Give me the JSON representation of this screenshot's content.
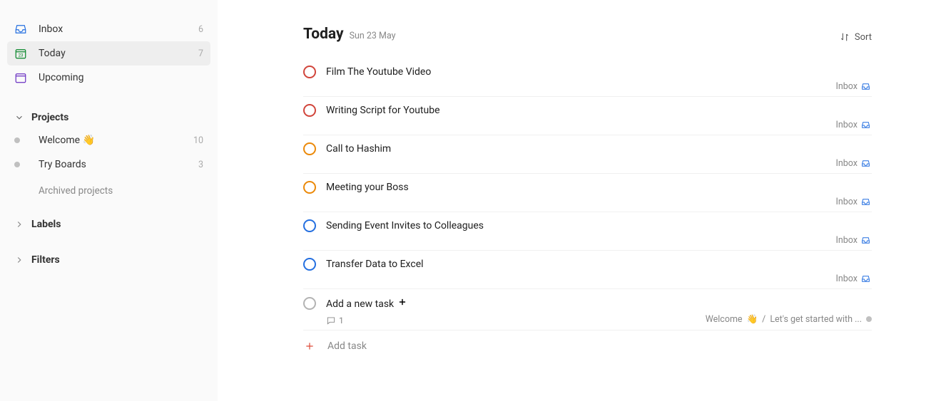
{
  "sidebar": {
    "nav": [
      {
        "key": "inbox",
        "label": "Inbox",
        "count": "6"
      },
      {
        "key": "today",
        "label": "Today",
        "count": "7"
      },
      {
        "key": "upcoming",
        "label": "Upcoming",
        "count": ""
      }
    ],
    "projects_header": "Projects",
    "projects": [
      {
        "label": "Welcome",
        "emoji": "👋",
        "count": "10"
      },
      {
        "label": "Try Boards",
        "emoji": "",
        "count": "3"
      }
    ],
    "archived_label": "Archived projects",
    "labels_header": "Labels",
    "filters_header": "Filters"
  },
  "header": {
    "title": "Today",
    "subtitle": "Sun 23 May",
    "sort_label": "Sort"
  },
  "tasks": [
    {
      "title": "Film The Youtube Video",
      "priority": "p1",
      "project": "Inbox"
    },
    {
      "title": "Writing Script for Youtube",
      "priority": "p1",
      "project": "Inbox"
    },
    {
      "title": "Call to Hashim",
      "priority": "p2",
      "project": "Inbox"
    },
    {
      "title": "Meeting your Boss",
      "priority": "p2",
      "project": "Inbox"
    },
    {
      "title": "Sending Event Invites to Colleagues",
      "priority": "p3",
      "project": "Inbox"
    },
    {
      "title": "Transfer Data to Excel",
      "priority": "p3",
      "project": "Inbox"
    }
  ],
  "special_task": {
    "title": "Add a new task",
    "comment_count": "1",
    "project_label": "Welcome",
    "project_emoji": "👋",
    "project_path_sep": "/",
    "project_path_rest": "Let's get started with ..."
  },
  "add_task_label": "Add task"
}
